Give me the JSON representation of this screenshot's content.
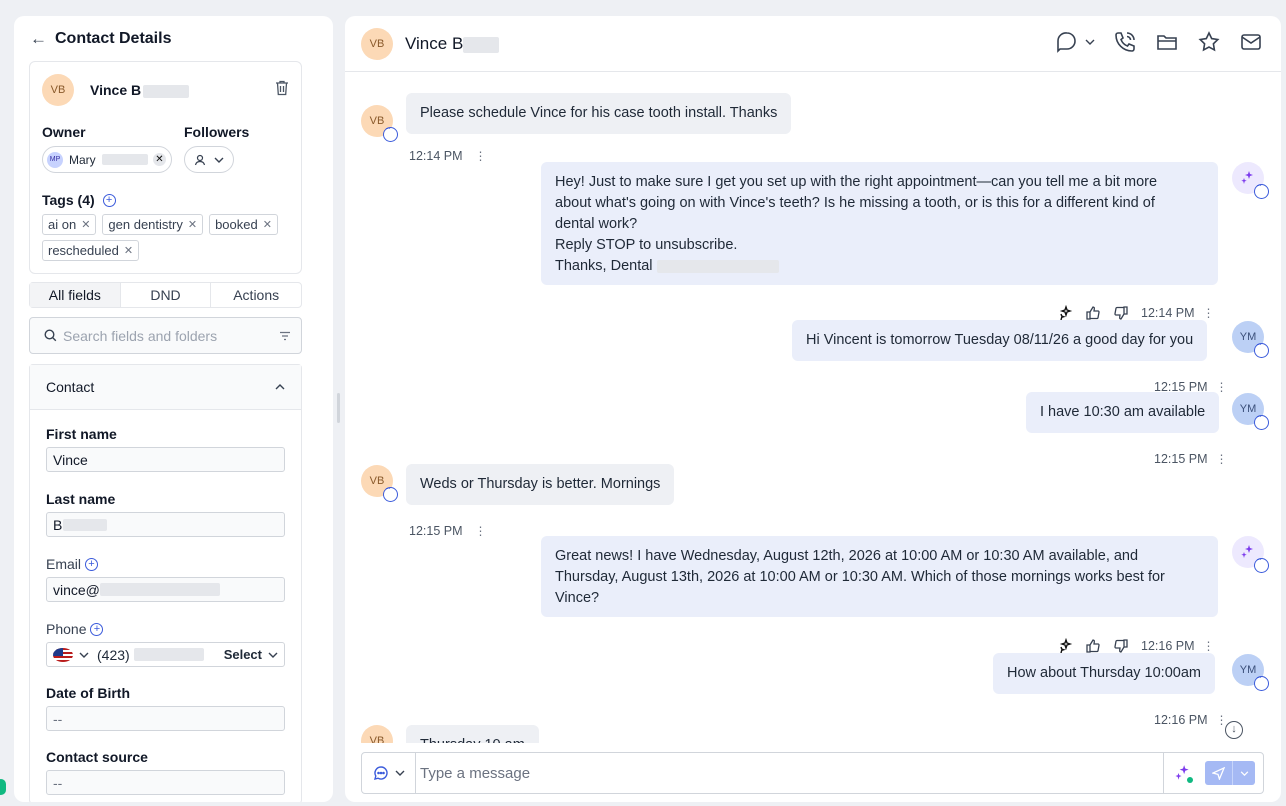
{
  "left": {
    "header_title": "Contact Details",
    "contact": {
      "initials": "VB",
      "name": "Vince B"
    },
    "owner_label": "Owner",
    "followers_label": "Followers",
    "owner": {
      "initials": "MP",
      "name": "Mary"
    },
    "tags_label": "Tags (4)",
    "tags": [
      "ai on",
      "gen dentistry",
      "booked",
      "rescheduled"
    ],
    "tabs": [
      "All fields",
      "DND",
      "Actions"
    ],
    "search_placeholder": "Search fields and folders",
    "section_title": "Contact",
    "fields": {
      "first_name_label": "First name",
      "first_name": "Vince",
      "last_name_label": "Last name",
      "last_name": "B",
      "email_label": "Email",
      "email": "vince@",
      "phone_label": "Phone",
      "phone": "(423)",
      "phone_select": "Select",
      "dob_label": "Date of Birth",
      "dob": "--",
      "source_label": "Contact source",
      "source": "--"
    }
  },
  "chat": {
    "contact_name": "Vince B",
    "contact_initials": "VB",
    "messages": [
      {
        "dir": "in",
        "initials": "VB",
        "text": "Please schedule Vince for his case tooth install. Thanks",
        "time": "12:14 PM"
      },
      {
        "dir": "out",
        "initials": "AI",
        "lines": [
          "Hey! Just to make sure I get you set up with the right appointment—can you tell me a bit more",
          "about what's going on with Vince's teeth? Is he missing a tooth, or is this for a different kind of",
          "dental work?",
          "Reply STOP to unsubscribe.",
          "Thanks, Dental"
        ],
        "time": "12:14 PM"
      },
      {
        "dir": "out",
        "initials": "YM",
        "text": "Hi Vincent is tomorrow Tuesday 08/11/26 a good day for you",
        "time": "12:15 PM"
      },
      {
        "dir": "out",
        "initials": "YM",
        "text": "I have 10:30 am available",
        "time": "12:15 PM"
      },
      {
        "dir": "in",
        "initials": "VB",
        "text": "Weds or Thursday is better. Mornings",
        "time": "12:15 PM"
      },
      {
        "dir": "out",
        "initials": "AI",
        "lines": [
          "Great news! I have Wednesday, August 12th, 2026 at 10:00 AM or 10:30 AM available, and",
          "Thursday, August 13th, 2026 at 10:00 AM or 10:30 AM. Which of those mornings works best for",
          "Vince?"
        ],
        "time": "12:16 PM"
      },
      {
        "dir": "out",
        "initials": "YM",
        "text": "How about Thursday 10:00am",
        "time": "12:16 PM"
      },
      {
        "dir": "in",
        "initials": "VB",
        "text": "Thursday 10 am",
        "time": ""
      }
    ],
    "composer_placeholder": "Type a message"
  },
  "colors": {
    "accent": "#3b5bdb",
    "ai": "#7c3aed",
    "send": "#a5b9f4"
  }
}
